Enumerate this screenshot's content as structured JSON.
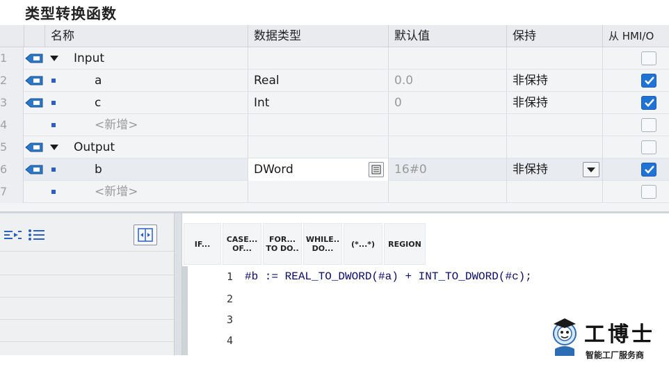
{
  "title": "类型转换函数",
  "table": {
    "headers": {
      "name": "名称",
      "data_type": "数据类型",
      "default": "默认值",
      "retain": "保持",
      "hmi": "从 HMI/O"
    },
    "rows": [
      {
        "num": "1",
        "name": "Input",
        "type": "",
        "default": "",
        "retain": "",
        "hmi": false
      },
      {
        "num": "2",
        "name": "a",
        "type": "Real",
        "default": "0.0",
        "retain": "非保持",
        "hmi": true
      },
      {
        "num": "3",
        "name": "c",
        "type": "Int",
        "default": "0",
        "retain": "非保持",
        "hmi": true
      },
      {
        "num": "4",
        "name": "<新增>",
        "type": "",
        "default": "",
        "retain": "",
        "hmi": false
      },
      {
        "num": "5",
        "name": "Output",
        "type": "",
        "default": "",
        "retain": "",
        "hmi": false
      },
      {
        "num": "6",
        "name": "b",
        "type": "DWord",
        "default": "16#0",
        "retain": "非保持",
        "hmi": true
      },
      {
        "num": "7",
        "name": "<新增>",
        "type": "",
        "default": "",
        "retain": "",
        "hmi": false
      }
    ]
  },
  "toolbar": {
    "if": "IF...",
    "case_1": "CASE...",
    "case_2": "OF...",
    "for_1": "FOR...",
    "for_2": "TO DO..",
    "while_1": "WHILE..",
    "while_2": "DO...",
    "comment": "(*...*)",
    "region": "REGION"
  },
  "code": {
    "lines": [
      {
        "n": "1",
        "text": "#b := REAL_TO_DWORD(#a) + INT_TO_DWORD(#c);"
      },
      {
        "n": "2",
        "text": ""
      },
      {
        "n": "3",
        "text": ""
      },
      {
        "n": "4",
        "text": ""
      }
    ]
  },
  "logo": {
    "brand": "工博士",
    "sub": "智能工厂服务商"
  },
  "colors": {
    "accent": "#1f73d6",
    "code_text": "#0a0a68",
    "row_bg": "#f3f4f6"
  }
}
